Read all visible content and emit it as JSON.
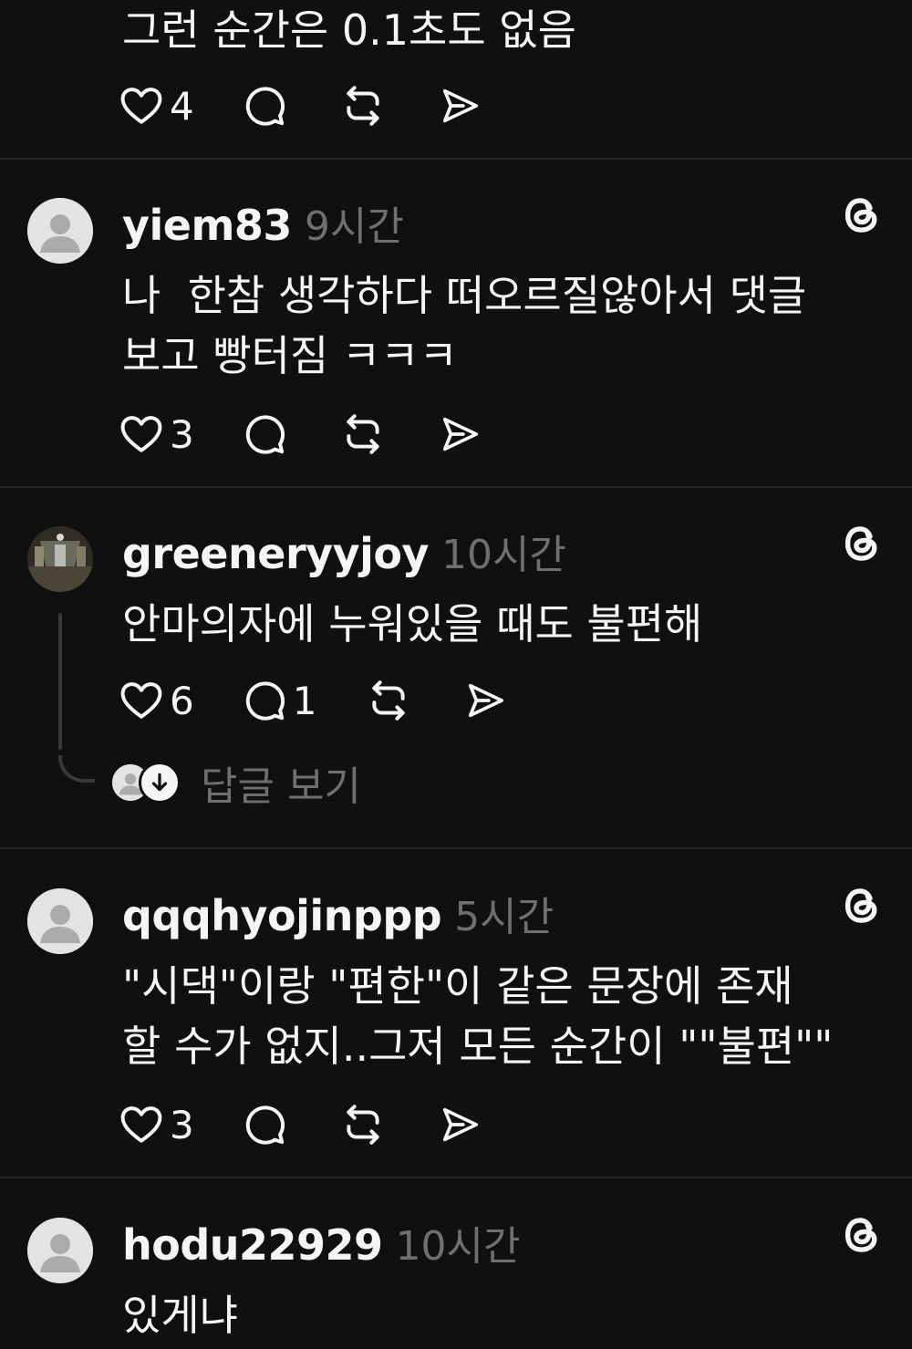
{
  "posts": [
    {
      "body": "그런 순간은 0.1초도 없음",
      "likes": "4"
    },
    {
      "username": "yiem83",
      "time": "9시간",
      "body": "나  한참 생각하다 떠오르질않아서 댓글\n보고 빵터짐 ㅋㅋㅋ",
      "likes": "3"
    },
    {
      "username": "greeneryyjoy",
      "time": "10시간",
      "body": "안마의자에 누워있을 때도 불편해",
      "likes": "6",
      "comments": "1",
      "view_replies": "답글 보기"
    },
    {
      "username": "qqqhyojinppp",
      "time": "5시간",
      "body": "\"시댁\"이랑 \"편한\"이 같은 문장에 존재\n할 수가 없지..그저 모든 순간이 \"\"불편\"\"",
      "likes": "3"
    },
    {
      "username": "hodu22929",
      "time": "10시간",
      "body": "있게냐"
    }
  ],
  "icons": {
    "like": "heart-icon",
    "comment": "comment-icon",
    "repost": "repost-icon",
    "share": "share-icon",
    "threads": "threads-logo-icon"
  },
  "colors": {
    "background": "#101010",
    "text": "#f3f5f7",
    "muted": "#6f6f6f",
    "divider": "#262626"
  }
}
